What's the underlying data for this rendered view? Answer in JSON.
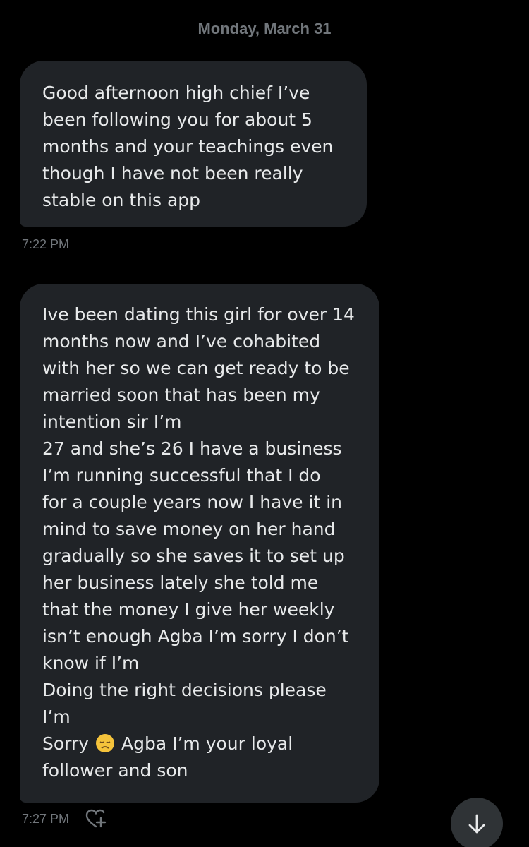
{
  "date_separator": "Monday, March 31",
  "messages": [
    {
      "text": "Good afternoon high chief I’ve\nbeen following you for about 5\nmonths and your teachings even\nthough I have not been really\nstable on this app",
      "time": "7:22 PM"
    },
    {
      "text_before_emoji": "Ive been dating this girl for over 14\nmonths now and I’ve cohabited\nwith her so we can get ready to be\nmarried soon that has been my\nintention sir I’m\n27 and she’s 26 I have a business\nI’m running successful that I do\nfor a couple years now I have it in\nmind to save money on her hand\ngradually so she saves it to set up\nher business lately she told me\nthat the money I give her weekly\nisn’t enough Agba I’m sorry I don’t\nknow if I’m\nDoing the right decisions please\nI’m\nSorry",
      "emoji": "disappointed-face",
      "text_after_emoji": "Agba I’m your loyal\nfollower and son",
      "time": "7:27 PM"
    }
  ],
  "icons": {
    "reaction": "add-reaction-heart-icon",
    "scroll": "arrow-down-icon"
  },
  "colors": {
    "background": "#000000",
    "bubble": "#202327",
    "text": "#e7e9ea",
    "muted": "#71767b",
    "scroll_button": "#2f3336"
  }
}
